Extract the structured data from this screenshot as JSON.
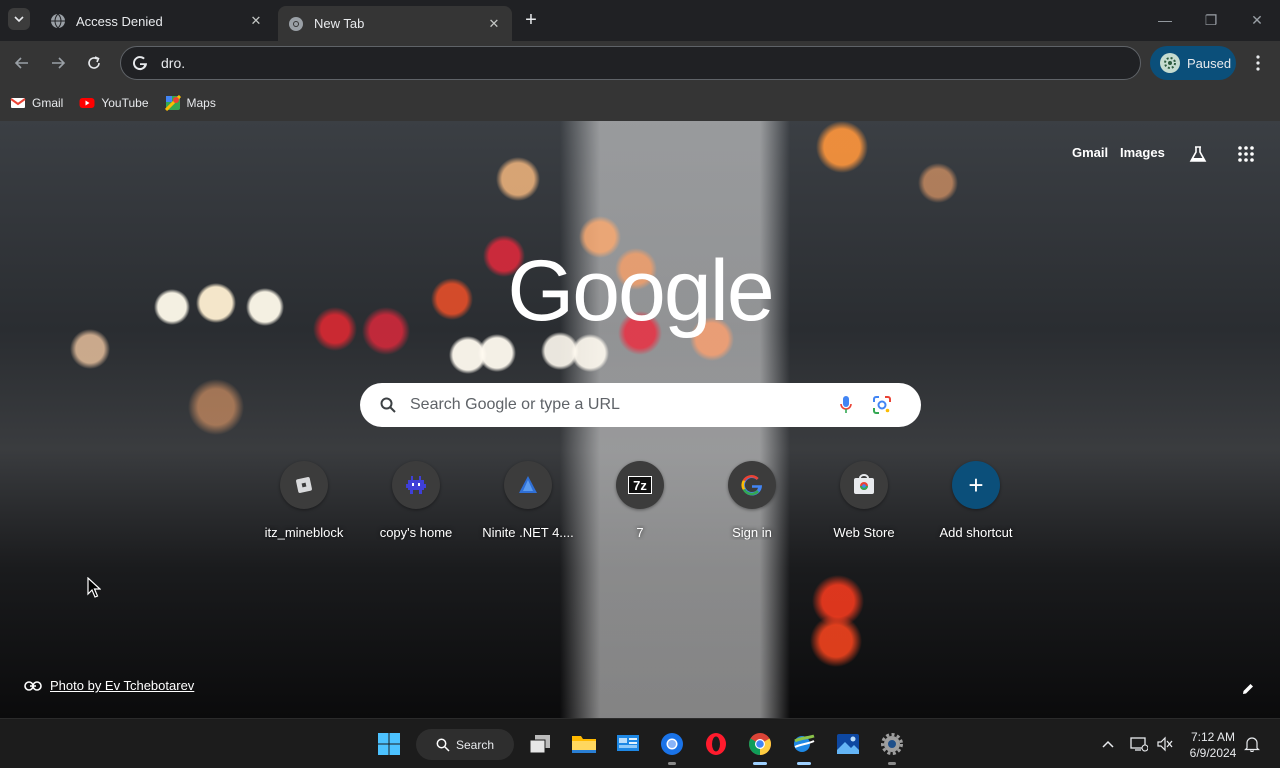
{
  "browser": {
    "tabs": [
      {
        "title": "Access Denied",
        "active": false
      },
      {
        "title": "New Tab",
        "active": true
      }
    ],
    "omnibox": {
      "value": "dro."
    },
    "profile": {
      "label": "Paused"
    },
    "bookmarks": [
      {
        "label": "Gmail",
        "icon": "gmail-icon"
      },
      {
        "label": "YouTube",
        "icon": "youtube-icon"
      },
      {
        "label": "Maps",
        "icon": "maps-icon"
      }
    ]
  },
  "ntp": {
    "header_links": {
      "gmail": "Gmail",
      "images": "Images"
    },
    "logo_text": "Google",
    "search_placeholder": "Search Google or type a URL",
    "shortcuts": [
      {
        "label": "itz_mineblock",
        "icon": "roblox-icon"
      },
      {
        "label": "copy's home",
        "icon": "pixel-alien-icon"
      },
      {
        "label": "Ninite .NET 4....",
        "icon": "ninite-icon"
      },
      {
        "label": "7",
        "icon": "7zip-icon"
      },
      {
        "label": "Sign in",
        "icon": "google-g-icon"
      },
      {
        "label": "Web Store",
        "icon": "web-store-icon"
      },
      {
        "label": "Add shortcut",
        "icon": "plus-icon"
      }
    ],
    "attribution": "Photo by Ev Tchebotarev"
  },
  "taskbar": {
    "search_label": "Search",
    "time": "7:12 AM",
    "date": "6/9/2024"
  },
  "colors": {
    "accent": "#0b4f7a",
    "tab_active_bg": "#353535",
    "window_bg": "#202124"
  }
}
